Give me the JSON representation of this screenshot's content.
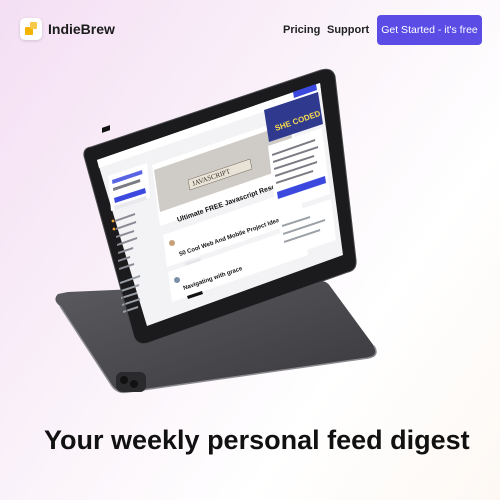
{
  "brand": {
    "name": "IndieBrew"
  },
  "nav": {
    "links": [
      "Pricing",
      "Support"
    ],
    "cta": "Get Started - it's free"
  },
  "hero": {
    "headline": "Your weekly personal feed digest"
  },
  "screen": {
    "promo_text": "DEV Community is a community of 684,519 amazing developers",
    "create_account": "Create account",
    "login": "Log in",
    "sidebar_items": [
      "Home",
      "Reading List",
      "Listings",
      "Podcasts",
      "Videos",
      "Tags",
      "FAQ"
    ],
    "popular_tags_title": "Popular Tags",
    "tags": [
      "#javascript",
      "#webdev",
      "#beginners",
      "#react",
      "#tutorial",
      "#python",
      "#programming",
      "#css"
    ],
    "feed_title": "Posts",
    "feed_tabs": [
      "Feed",
      "Week",
      "Month",
      "Year",
      "Infinity",
      "Latest"
    ],
    "hero_image_word": "JAVASCRIPT",
    "posts": [
      "Ultimate FREE Javascript Resources",
      "50 Cool Web And Mobile Project Ideas for 2021",
      "Navigating with grace"
    ],
    "side_banner": "SHE CODED",
    "side_list_title": "Shecoded (156)",
    "listings_title": "Listings"
  },
  "colors": {
    "accent": "#5b4ce6",
    "text": "#111111"
  }
}
